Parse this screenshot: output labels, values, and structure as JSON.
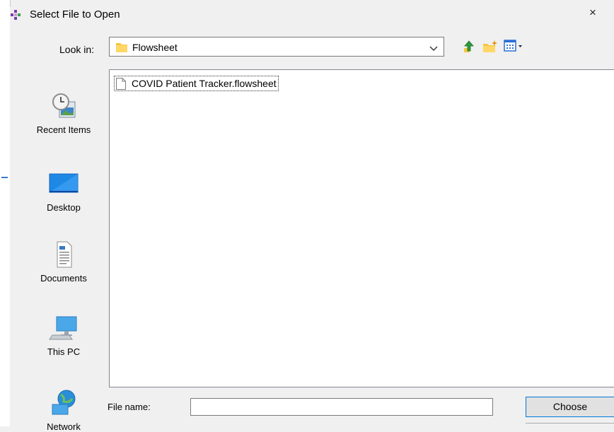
{
  "dialog": {
    "title": "Select File to Open",
    "close_glyph": "×"
  },
  "look_in": {
    "label": "Look in:",
    "value": "Flowsheet"
  },
  "toolbar": {
    "icons": [
      "up-one-level-icon",
      "new-folder-icon",
      "view-menu-icon"
    ]
  },
  "places": [
    {
      "label": "Recent Items",
      "icon": "recent-items-icon"
    },
    {
      "label": "Desktop",
      "icon": "desktop-icon"
    },
    {
      "label": "Documents",
      "icon": "documents-icon"
    },
    {
      "label": "This PC",
      "icon": "this-pc-icon"
    },
    {
      "label": "Network",
      "icon": "network-icon"
    }
  ],
  "files": [
    {
      "name": "COVID Patient Tracker.flowsheet",
      "icon": "file-icon"
    }
  ],
  "file_name": {
    "label": "File name:",
    "value": ""
  },
  "buttons": {
    "choose": "Choose"
  },
  "colors": {
    "accent": "#0078d7",
    "folder": "#f5c542",
    "window_bg": "#f0f0f0"
  }
}
